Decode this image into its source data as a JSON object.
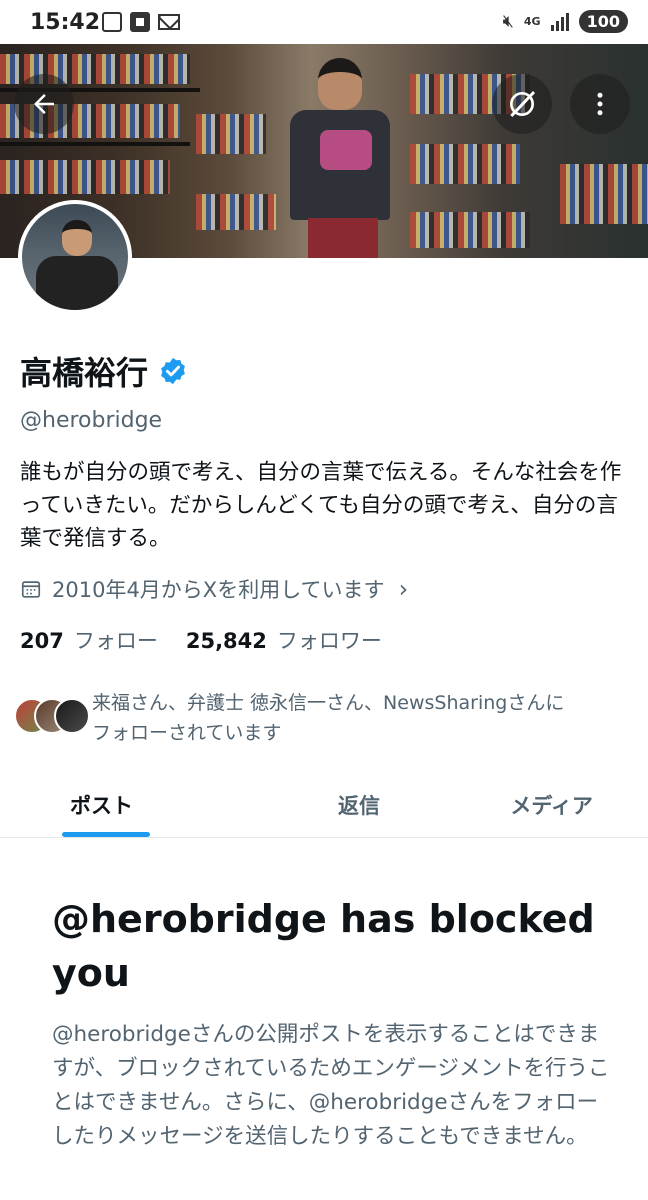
{
  "status_bar": {
    "time": "15:42",
    "network": "4G",
    "battery": "100",
    "icons": [
      "notification-box-icon",
      "notification-au-icon",
      "mail-icon",
      "mute-icon",
      "signal-icon"
    ]
  },
  "banner": {
    "back_icon": "arrow-left-icon",
    "search_icon": "grok-icon",
    "more_icon": "more-vertical-icon"
  },
  "profile": {
    "name": "高橋裕行",
    "verified": true,
    "handle": "@herobridge",
    "bio": "誰もが自分の頭で考え、自分の言葉で伝える。そんな社会を作っていきたい。だからしんどくても自分の頭で考え、自分の言葉で発信する。",
    "joined": "2010年4月からXを利用しています",
    "following_count": "207",
    "following_label": "フォロー",
    "followers_count": "25,842",
    "followers_label": "フォロワー",
    "followed_by_line1": "来福さん、弁護士 徳永信一さん、NewsSharingさんに",
    "followed_by_line2": "フォローされています"
  },
  "tabs": [
    {
      "label": "ポスト",
      "active": true
    },
    {
      "label": "返信",
      "active": false
    },
    {
      "label": "メディア",
      "active": false
    }
  ],
  "blocked_notice": {
    "title": "@herobridge has blocked you",
    "body": "@herobridgeさんの公開ポストを表示することはできますが、ブロックされているためエンゲージメントを行うことはできません。さらに、@herobridgeさんをフォローしたりメッセージを送信したりすることもできません。"
  },
  "colors": {
    "accent": "#1d9bf0",
    "secondary_text": "#536471",
    "primary_text": "#0f1419"
  }
}
